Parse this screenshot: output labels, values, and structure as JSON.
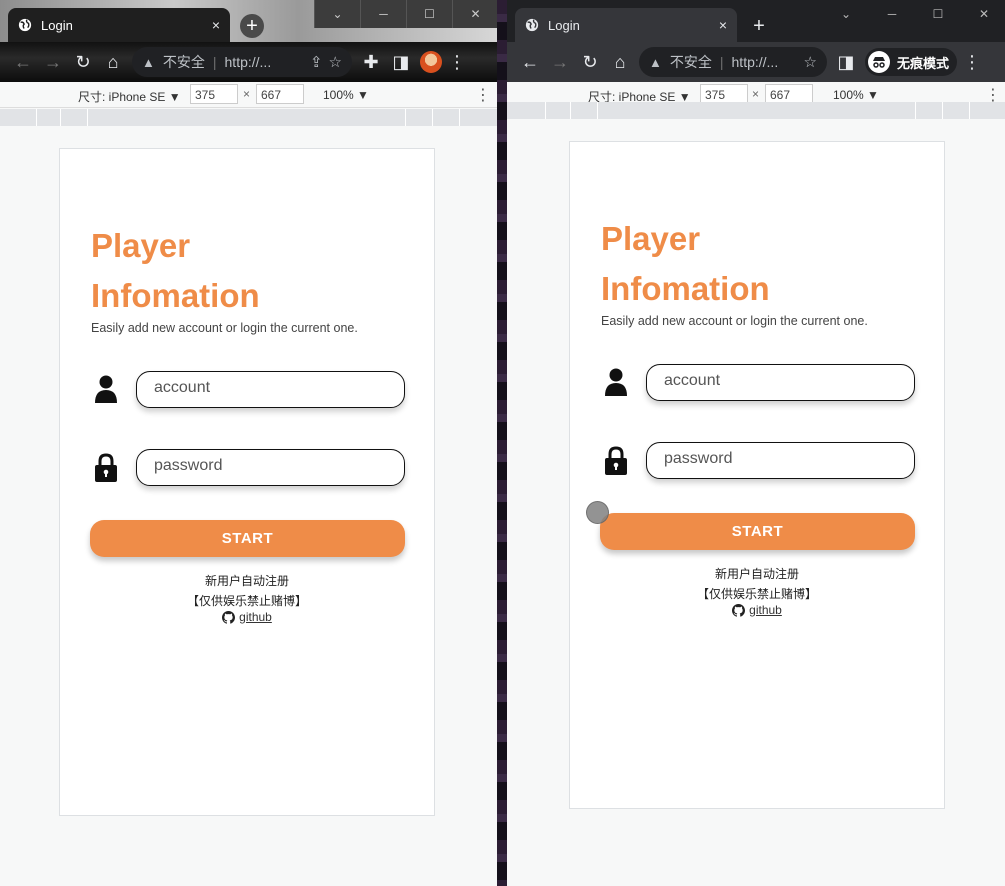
{
  "windows": [
    {
      "tab": {
        "title": "Login",
        "close": "×"
      },
      "omnibox": {
        "warning": "不安全",
        "url": "http://..."
      },
      "device": {
        "name": "尺寸: iPhone SE ▼",
        "width": "375",
        "height": "667",
        "times": "×",
        "zoom": "100% ▼",
        "more": "⋮"
      },
      "page": {
        "title_line1": "Player",
        "title_line2": "Infomation",
        "subtitle": "Easily add new account or login the current one.",
        "account_placeholder": "account",
        "password_placeholder": "password",
        "start_label": "START",
        "auto_register": "新用户自动注册",
        "notice": "【仅供娱乐禁止赌博】",
        "github_label": "github"
      }
    },
    {
      "tab": {
        "title": "Login",
        "close": "×"
      },
      "omnibox": {
        "warning": "不安全",
        "url": "http://..."
      },
      "incognito_label": "无痕模式",
      "device": {
        "name": "尺寸: iPhone SE ▼",
        "width": "375",
        "height": "667",
        "times": "×",
        "zoom": "100% ▼",
        "more": "⋮"
      },
      "page": {
        "title_line1": "Player",
        "title_line2": "Infomation",
        "subtitle": "Easily add new account or login the current one.",
        "account_placeholder": "account",
        "password_placeholder": "password",
        "start_label": "START",
        "auto_register": "新用户自动注册",
        "notice": "【仅供娱乐禁止赌博】",
        "github_label": "github"
      }
    }
  ],
  "colors": {
    "accent": "#ef8c48",
    "card_border": "#dde0e3"
  }
}
